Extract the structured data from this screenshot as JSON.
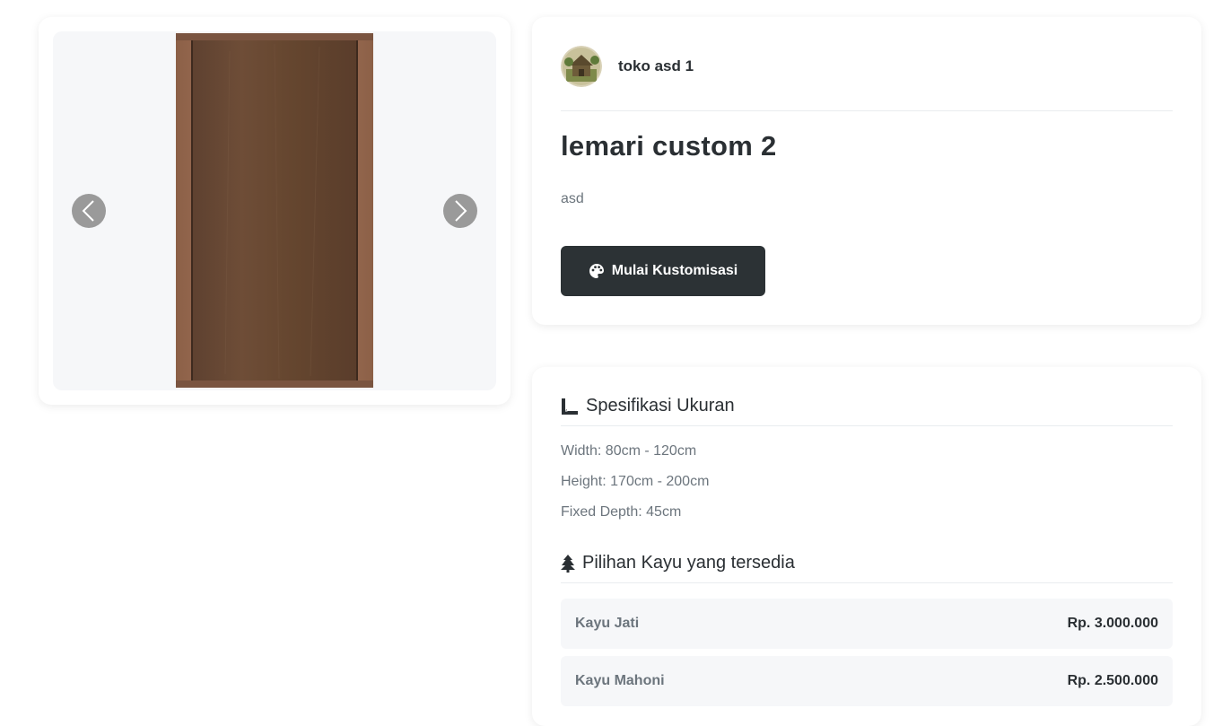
{
  "gallery": {
    "prev_icon": "chevron-left-icon",
    "next_icon": "chevron-right-icon"
  },
  "store": {
    "name": "toko asd 1"
  },
  "product": {
    "title": "lemari custom 2",
    "description": "asd",
    "cta_label": "Mulai Kustomisasi",
    "cta_icon": "palette-icon"
  },
  "specs": {
    "heading": "Spesifikasi Ukuran",
    "heading_icon": "ruler-icon",
    "lines": [
      "Width: 80cm - 120cm",
      "Height: 170cm - 200cm",
      "Fixed Depth: 45cm"
    ]
  },
  "woods": {
    "heading": "Pilihan Kayu yang tersedia",
    "heading_icon": "tree-icon",
    "items": [
      {
        "name": "Kayu Jati",
        "price": "Rp. 3.000.000"
      },
      {
        "name": "Kayu Mahoni",
        "price": "Rp. 2.500.000"
      }
    ]
  },
  "colors": {
    "primary_button": "#2c3235",
    "wood_dark": "#6b4a33",
    "wood_frame": "#a0735a"
  }
}
